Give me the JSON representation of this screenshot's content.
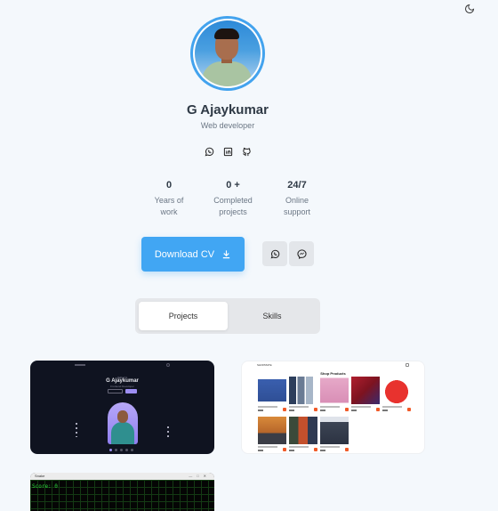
{
  "theme_toggle": {
    "icon": "moon-icon"
  },
  "profile": {
    "name": "G Ajaykumar",
    "title": "Web developer"
  },
  "socials": [
    {
      "icon": "whatsapp-icon"
    },
    {
      "icon": "linkedin-icon"
    },
    {
      "icon": "github-icon"
    }
  ],
  "stats": [
    {
      "value": "0",
      "label_line1": "Years of",
      "label_line2": "work"
    },
    {
      "value": "0 +",
      "label_line1": "Completed",
      "label_line2": "projects"
    },
    {
      "value": "24/7",
      "label_line1": "Online",
      "label_line2": "support"
    }
  ],
  "actions": {
    "download_label": "Download CV",
    "download_icon": "download-icon",
    "whatsapp_icon": "whatsapp-icon",
    "messenger_icon": "messenger-icon",
    "accent_color": "#41a6f3"
  },
  "tabs": [
    {
      "label": "Projects",
      "active": true
    },
    {
      "label": "Skills",
      "active": false
    }
  ],
  "projects": {
    "card1": {
      "name": "G Ajaykumar"
    },
    "card2": {
      "heading": "Shop Products",
      "brand": "SHOPMATE"
    },
    "card3": {
      "window_title": "Snake",
      "score_text": "Score: 0"
    }
  }
}
